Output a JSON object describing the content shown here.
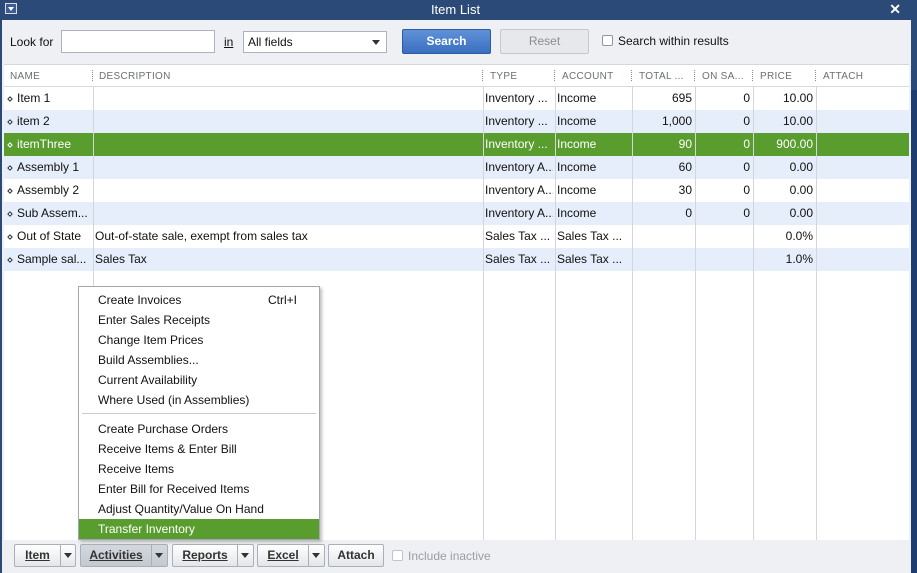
{
  "window": {
    "title": "Item List"
  },
  "search": {
    "look_for_label": "Look for",
    "look_for_value": "",
    "in_label": "in",
    "field_selected": "All fields",
    "search_button": "Search",
    "reset_button": "Reset",
    "within_results_label": "Search within results",
    "within_results_checked": false
  },
  "table": {
    "columns": [
      "NAME",
      "DESCRIPTION",
      "TYPE",
      "ACCOUNT",
      "TOTAL ...",
      "ON SA...",
      "PRICE",
      "ATTACH"
    ],
    "rows": [
      {
        "name": "Item 1",
        "description": "",
        "type": "Inventory ...",
        "account": "Income",
        "total": "695",
        "on_sales": "0",
        "price": "10.00",
        "attach": ""
      },
      {
        "name": "item 2",
        "description": "",
        "type": "Inventory ...",
        "account": "Income",
        "total": "1,000",
        "on_sales": "0",
        "price": "10.00",
        "attach": ""
      },
      {
        "name": "itemThree",
        "description": "",
        "type": "Inventory ...",
        "account": "Income",
        "total": "90",
        "on_sales": "0",
        "price": "900.00",
        "attach": ""
      },
      {
        "name": "Assembly 1",
        "description": "",
        "type": "Inventory A...",
        "account": "Income",
        "total": "60",
        "on_sales": "0",
        "price": "0.00",
        "attach": ""
      },
      {
        "name": "Assembly 2",
        "description": "",
        "type": "Inventory A...",
        "account": "Income",
        "total": "30",
        "on_sales": "0",
        "price": "0.00",
        "attach": ""
      },
      {
        "name": "Sub Assem...",
        "description": "",
        "type": "Inventory A...",
        "account": "Income",
        "total": "0",
        "on_sales": "0",
        "price": "0.00",
        "attach": ""
      },
      {
        "name": "Out of State",
        "description": "Out-of-state sale, exempt from sales tax",
        "type": "Sales Tax ...",
        "account": "Sales Tax ...",
        "total": "",
        "on_sales": "",
        "price": "0.0%",
        "attach": ""
      },
      {
        "name": "Sample sal...",
        "description": "Sales Tax",
        "type": "Sales Tax ...",
        "account": "Sales Tax ...",
        "total": "",
        "on_sales": "",
        "price": "1.0%",
        "attach": ""
      }
    ],
    "selected_row": "itemThree"
  },
  "menu": {
    "items": [
      {
        "label": "Create Invoices",
        "shortcut": "Ctrl+I"
      },
      {
        "label": "Enter Sales Receipts",
        "shortcut": ""
      },
      {
        "label": "Change Item Prices",
        "shortcut": ""
      },
      {
        "label": "Build Assemblies...",
        "shortcut": ""
      },
      {
        "label": "Current Availability",
        "shortcut": ""
      },
      {
        "label": "Where Used (in Assemblies)",
        "shortcut": ""
      },
      {
        "label": "Create Purchase Orders",
        "shortcut": ""
      },
      {
        "label": "Receive Items & Enter Bill",
        "shortcut": ""
      },
      {
        "label": "Receive Items",
        "shortcut": ""
      },
      {
        "label": "Enter Bill for Received Items",
        "shortcut": ""
      },
      {
        "label": "Adjust Quantity/Value On Hand",
        "shortcut": ""
      },
      {
        "label": "Transfer Inventory",
        "shortcut": ""
      }
    ],
    "highlighted": "Transfer Inventory"
  },
  "bottom": {
    "item_button": "Item",
    "activities_button": "Activities",
    "reports_button": "Reports",
    "excel_button": "Excel",
    "attach_button": "Attach",
    "include_inactive_label": "Include inactive",
    "include_inactive_checked": false
  },
  "colors": {
    "titlebar": "#2c4a78",
    "selection": "#5a9d2f",
    "alt_row": "#e5eefa",
    "search_button": "#3a6fc0"
  }
}
